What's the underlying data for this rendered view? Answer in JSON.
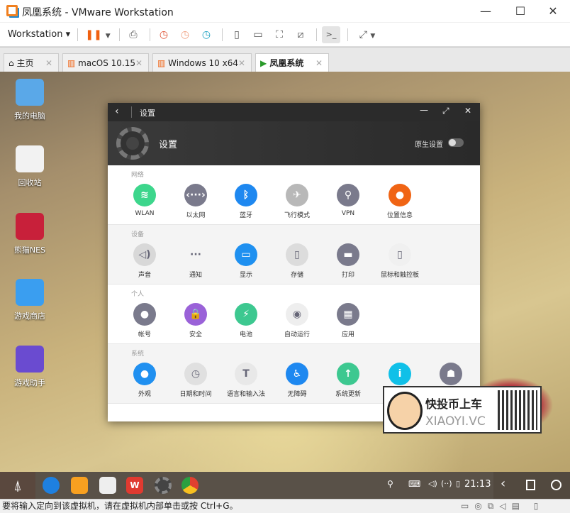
{
  "window": {
    "title": "凤凰系统 - VMware Workstation",
    "min": "—",
    "max": "☐",
    "close": "✕"
  },
  "toolbar": {
    "workstation": "Workstation ▾"
  },
  "tabs": [
    {
      "label": "主页"
    },
    {
      "label": "macOS 10.15"
    },
    {
      "label": "Windows 10 x64"
    },
    {
      "label": "凤凰系统"
    }
  ],
  "desktop": [
    {
      "label": "我的电脑",
      "color": "#5aa8e8"
    },
    {
      "label": "回收站",
      "color": "#f2f2f2"
    },
    {
      "label": "熊猫NES",
      "color": "#c8203a"
    },
    {
      "label": "游戏商店",
      "color": "#3a9ef0"
    },
    {
      "label": "游戏助手",
      "color": "#6a4bd0"
    }
  ],
  "settings": {
    "title": "设置",
    "banner_title": "设置",
    "native_label": "原生设置",
    "sections": [
      {
        "header": "网络",
        "items": [
          {
            "label": "WLAN",
            "name": "wifi",
            "color": "#3dd68c",
            "glyph": "≋"
          },
          {
            "label": "以太网",
            "name": "ethernet",
            "color": "#7a7a8c",
            "glyph": "‹···›"
          },
          {
            "label": "蓝牙",
            "name": "bluetooth",
            "color": "#1e88f0",
            "glyph": "ᛒ"
          },
          {
            "label": "飞行模式",
            "name": "airplane",
            "color": "#b8b8b8",
            "glyph": "✈"
          },
          {
            "label": "VPN",
            "name": "vpn",
            "color": "#7a7a8c",
            "glyph": "⚲"
          },
          {
            "label": "位置信息",
            "name": "location",
            "color": "#f06414",
            "glyph": "●"
          }
        ]
      },
      {
        "header": "设备",
        "items": [
          {
            "label": "声音",
            "name": "speaker",
            "color": "#d8d8d8",
            "glyph": "◁)"
          },
          {
            "label": "通知",
            "name": "notification",
            "color": "#f4f4f4",
            "glyph": "···"
          },
          {
            "label": "显示",
            "name": "display",
            "color": "#1e90f0",
            "glyph": "▭"
          },
          {
            "label": "存储",
            "name": "storage",
            "color": "#dcdcdc",
            "glyph": "▯"
          },
          {
            "label": "打印",
            "name": "printer",
            "color": "#7a7a8c",
            "glyph": "▬"
          },
          {
            "label": "鼠标和触控板",
            "name": "mouse",
            "color": "#f0f0f0",
            "glyph": "▯"
          }
        ]
      },
      {
        "header": "个人",
        "items": [
          {
            "label": "帐号",
            "name": "account",
            "color": "#7a7a8c",
            "glyph": "●"
          },
          {
            "label": "安全",
            "name": "lock",
            "color": "#9a62d8",
            "glyph": "🔒"
          },
          {
            "label": "电池",
            "name": "battery",
            "color": "#3dc890",
            "glyph": "⚡"
          },
          {
            "label": "自动运行",
            "name": "toggle",
            "color": "#eeeeee",
            "glyph": "◉"
          },
          {
            "label": "应用",
            "name": "apps",
            "color": "#7a7a8c",
            "glyph": "▦"
          }
        ]
      },
      {
        "header": "系统",
        "items": [
          {
            "label": "外观",
            "name": "appearance",
            "color": "#2090f0",
            "glyph": "●"
          },
          {
            "label": "日期和时间",
            "name": "clock",
            "color": "#e0e0e0",
            "glyph": "◷"
          },
          {
            "label": "语言和输入法",
            "name": "language",
            "color": "#e8e8e8",
            "glyph": "T"
          },
          {
            "label": "无障碍",
            "name": "accessibility",
            "color": "#1e88f0",
            "glyph": "♿"
          },
          {
            "label": "系统更新",
            "name": "update",
            "color": "#3dc890",
            "glyph": "↑"
          },
          {
            "label": "关于",
            "name": "info",
            "color": "#10c0e8",
            "glyph": "i"
          },
          {
            "label": "Android",
            "name": "android",
            "color": "#7a7a8c",
            "glyph": "☗"
          }
        ]
      }
    ]
  },
  "promo": {
    "line1": "快投币上车",
    "line2": "XIAOYI.VC"
  },
  "taskbar": {
    "time": "21:13"
  },
  "status": {
    "message": "要将输入定向到该虚拟机，请在虚拟机内部单击或按 Ctrl+G。"
  }
}
